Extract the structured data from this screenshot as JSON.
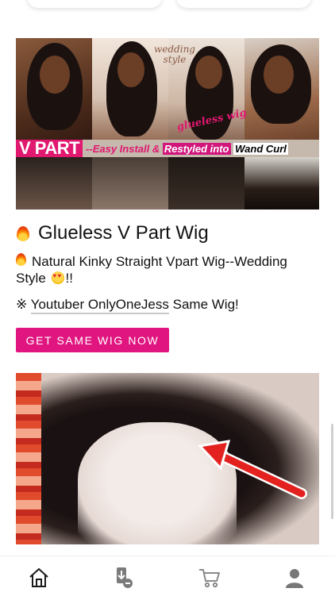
{
  "product": {
    "banner": {
      "vpart": "V PART",
      "easy": "--Easy Install &",
      "restyled": "Restyled into",
      "wand": "Wand Curl"
    },
    "overlay_wedding": "wedding style",
    "overlay_glueless": "glueless wig",
    "title": "Glueless V Part Wig",
    "subtitle": "Natural Kinky Straight Vpart Wig--Wedding Style",
    "subtitle_suffix": "!!",
    "youtuber_prefix": "※",
    "youtuber_link": "Youtuber OnlyOneJess",
    "youtuber_suffix": "Same Wig!",
    "cta_label": "GET SAME WIG NOW"
  },
  "bottom_nav": {
    "items": [
      "home-icon",
      "download-icon",
      "cart-icon",
      "user-icon"
    ]
  },
  "colors": {
    "accent": "#e0157f",
    "fire": "#ff8a00"
  }
}
